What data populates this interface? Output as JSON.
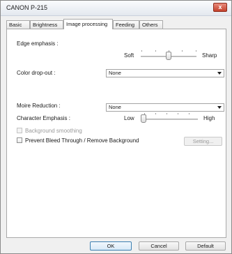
{
  "window": {
    "title": "CANON  P-215",
    "close_symbol": "x"
  },
  "tabs": [
    {
      "label": "Basic",
      "active": false
    },
    {
      "label": "Brightness",
      "active": false
    },
    {
      "label": "Image processing",
      "active": true
    },
    {
      "label": "Feeding",
      "active": false
    },
    {
      "label": "Others",
      "active": false
    }
  ],
  "edge_emphasis": {
    "label": "Edge emphasis :",
    "min_label": "Soft",
    "max_label": "Sharp",
    "level": 0.5
  },
  "color_dropout": {
    "label": "Color drop-out :",
    "value": "None"
  },
  "moire_reduction": {
    "label": "Moire Reduction :",
    "value": "None"
  },
  "character_emphasis": {
    "label": "Character Emphasis :",
    "min_label": "Low",
    "max_label": "High",
    "level": 0.0
  },
  "background_smoothing": {
    "label": "Background smoothing",
    "checked": false,
    "enabled": false
  },
  "prevent_bleed": {
    "label": "Prevent Bleed Through / Remove Background",
    "checked": false,
    "enabled": true
  },
  "setting_button": {
    "label": "Setting...",
    "enabled": false
  },
  "footer": {
    "ok": "OK",
    "cancel": "Cancel",
    "default": "Default"
  },
  "colors": {
    "accent": "#3c7fb1",
    "close": "#c4412b"
  }
}
